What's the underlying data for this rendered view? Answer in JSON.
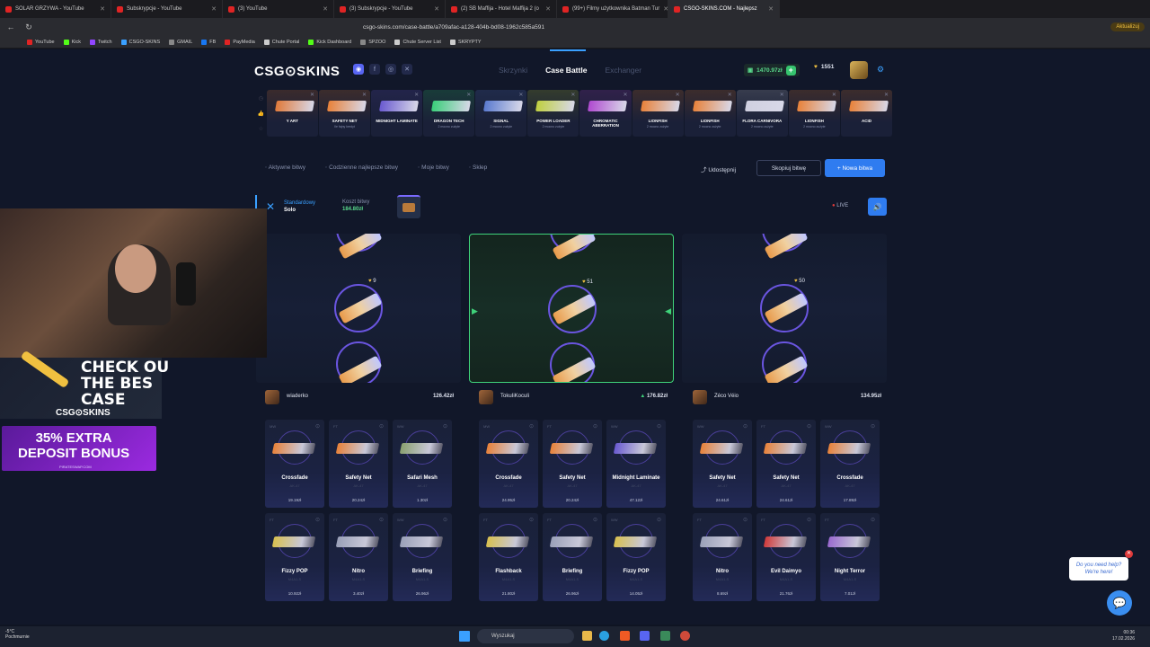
{
  "browser": {
    "tabs": [
      {
        "label": "SOLAR GRZYWA - YouTube",
        "active": false
      },
      {
        "label": "Subskrypcje - YouTube",
        "active": false
      },
      {
        "label": "(3) YouTube",
        "active": false
      },
      {
        "label": "(3) Subskrypcje - YouTube",
        "active": false
      },
      {
        "label": "(2) SB Maffija - Hotel Maffija 2 (o",
        "active": false
      },
      {
        "label": "(99+) Filmy użytkownika Batman Tur",
        "active": false
      },
      {
        "label": "CSGO-SKINS.COM - Najlepsz",
        "active": true
      }
    ],
    "url": "csgo-skins.com/case-battle/a709afac-a128-404b-bd08-1962c585a591",
    "action_label": "Aktualizuj",
    "bookmarks": [
      {
        "label": "YouTube",
        "color": "#e02424"
      },
      {
        "label": "Kick",
        "color": "#53fc18"
      },
      {
        "label": "Twitch",
        "color": "#9146ff"
      },
      {
        "label": "CSGO-SKINS",
        "color": "#3aa0ff"
      },
      {
        "label": "GMAIL",
        "color": "#888888"
      },
      {
        "label": "FB",
        "color": "#1877f2"
      },
      {
        "label": "PayMedia",
        "color": "#e02424"
      },
      {
        "label": "Chute Portal",
        "color": "#cccccc"
      },
      {
        "label": "Kick Dashboard",
        "color": "#53fc18"
      },
      {
        "label": "SPZOO",
        "color": "#888888"
      },
      {
        "label": "Chute Server List",
        "color": "#cccccc"
      },
      {
        "label": "SKRYPTY",
        "color": "#cccccc"
      }
    ]
  },
  "site": {
    "logo": "CSG⊙SKINS",
    "nav": [
      {
        "label": "Skrzynki",
        "active": false
      },
      {
        "label": "Case Battle",
        "active": true
      },
      {
        "label": "Exchanger",
        "active": false
      }
    ],
    "balance": "1470.97zł",
    "coins": "1551",
    "socials": [
      "discord-icon",
      "facebook-icon",
      "instagram-icon",
      "x-icon"
    ]
  },
  "drops": [
    {
      "name": "Y ART",
      "sub": "",
      "color": "#e07a3a"
    },
    {
      "name": "SAFETY NET",
      "sub": "Ile fajny kredyt",
      "color": "#e8823a"
    },
    {
      "name": "MIDNIGHT LAMINATE",
      "sub": "",
      "color": "#6a5ad0"
    },
    {
      "name": "DRAGON TECH",
      "sub": "2 mocno zużyte",
      "color": "#3acf7a"
    },
    {
      "name": "SIGNAL",
      "sub": "2 mocno zużyte",
      "color": "#5a7ad0"
    },
    {
      "name": "POWER LOADER",
      "sub": "2 mocno zużyte",
      "color": "#c0d040"
    },
    {
      "name": "CHROMATIC ABERRATION",
      "sub": "",
      "color": "#b04ad0"
    },
    {
      "name": "LIONFISH",
      "sub": "2 mocno zużyte",
      "color": "#e8823a"
    },
    {
      "name": "LIONFISH",
      "sub": "2 mocno zużyte",
      "color": "#e8823a"
    },
    {
      "name": "FLORA CARNIVORA",
      "sub": "2 mocno zużyte",
      "color": "#d0d0e0"
    },
    {
      "name": "LIONFISH",
      "sub": "2 mocno zużyte",
      "color": "#e8823a"
    },
    {
      "name": "ACID",
      "sub": "",
      "color": "#e8823a"
    }
  ],
  "subnav": {
    "items": [
      "Aktywne bitwy",
      "Codzienne najlepsze bitwy",
      "Moje bitwy",
      "Sklep"
    ],
    "share": "Udostępnij",
    "copy": "Skopiuj bitwę",
    "new": "+ Nowa bitwa"
  },
  "battle": {
    "mode_top": "Standardowy",
    "mode_bottom": "Solo",
    "cost_label": "Koszt bitwy",
    "cost_value": "184.80zł",
    "live": "LIVE",
    "spinners": [
      {
        "coins": "9",
        "winner": false
      },
      {
        "coins": "51",
        "winner": true
      },
      {
        "coins": "50",
        "winner": false
      }
    ],
    "players": [
      {
        "name": "wiaderko",
        "total": "126.42zł",
        "up": false,
        "items": [
          {
            "name": "Crossfade",
            "sub": "AK-47",
            "price": "19.19zł",
            "q": "MW",
            "color": "#e8823a"
          },
          {
            "name": "Safety Net",
            "sub": "AK-47",
            "price": "20.24zł",
            "q": "FT",
            "color": "#e8823a"
          },
          {
            "name": "Safari Mesh",
            "sub": "AK-47",
            "price": "1.30zł",
            "q": "WW",
            "color": "#8aa070"
          },
          {
            "name": "Fizzy POP",
            "sub": "M4A1-S",
            "price": "10.92zł",
            "q": "FT",
            "color": "#d8c050"
          },
          {
            "name": "Nitro",
            "sub": "M4A1-S",
            "price": "3.40zł",
            "q": "FT",
            "color": "#9aa0b8"
          },
          {
            "name": "Briefing",
            "sub": "M4A1-S",
            "price": "26.96zł",
            "q": "WW",
            "color": "#9aa0b8"
          }
        ]
      },
      {
        "name": "TokuIiKoculi",
        "total": "176.82zł",
        "up": true,
        "items": [
          {
            "name": "Crossfade",
            "sub": "AK-47",
            "price": "24.95zł",
            "q": "MW",
            "color": "#e8823a"
          },
          {
            "name": "Safety Net",
            "sub": "AK-47",
            "price": "20.24zł",
            "q": "FT",
            "color": "#e8823a"
          },
          {
            "name": "Midnight Laminate",
            "sub": "AK-47",
            "price": "47.12zł",
            "q": "WW",
            "color": "#6a5ad0"
          },
          {
            "name": "Flashback",
            "sub": "M4A1-S",
            "price": "21.80zł",
            "q": "FT",
            "color": "#d8c050"
          },
          {
            "name": "Briefing",
            "sub": "M4A1-S",
            "price": "26.96zł",
            "q": "FT",
            "color": "#9aa0b8"
          },
          {
            "name": "Fizzy POP",
            "sub": "M4A1-S",
            "price": "14.05zł",
            "q": "WW",
            "color": "#d8c050"
          }
        ]
      },
      {
        "name": "Zéco Véio",
        "total": "134.95zł",
        "up": false,
        "items": [
          {
            "name": "Safety Net",
            "sub": "AK-47",
            "price": "24.61zł",
            "q": "WW",
            "color": "#e8823a"
          },
          {
            "name": "Safety Net",
            "sub": "AK-47",
            "price": "24.61zł",
            "q": "FT",
            "color": "#e8823a"
          },
          {
            "name": "Crossfade",
            "sub": "AK-47",
            "price": "17.89zł",
            "q": "WW",
            "color": "#e8823a"
          },
          {
            "name": "Nitro",
            "sub": "M4A1-S",
            "price": "8.69zł",
            "q": "FT",
            "color": "#9aa0b8"
          },
          {
            "name": "Evil Daimyo",
            "sub": "M4A1-S",
            "price": "21.76zł",
            "q": "FT",
            "color": "#d03a3a"
          },
          {
            "name": "Night Terror",
            "sub": "M4A1-S",
            "price": "7.01zł",
            "q": "FT",
            "color": "#9a6ad0"
          }
        ]
      }
    ]
  },
  "overlay": {
    "promo1_text": "CHECK OU\nTHE BES\nCASE",
    "promo1_brand": "CSG⊙SKINS",
    "promo2_text": "35% EXTRA\nDEPOSIT BONUS",
    "promo2_sub": "PIRATESWAP.COM",
    "chat_text": "Do you need help?\nWe're here!"
  },
  "taskbar": {
    "weather_temp": "-5°C",
    "weather_desc": "Pochmurnie",
    "search": "Wyszukaj",
    "time": "00:36",
    "date": "17.02.2026"
  }
}
